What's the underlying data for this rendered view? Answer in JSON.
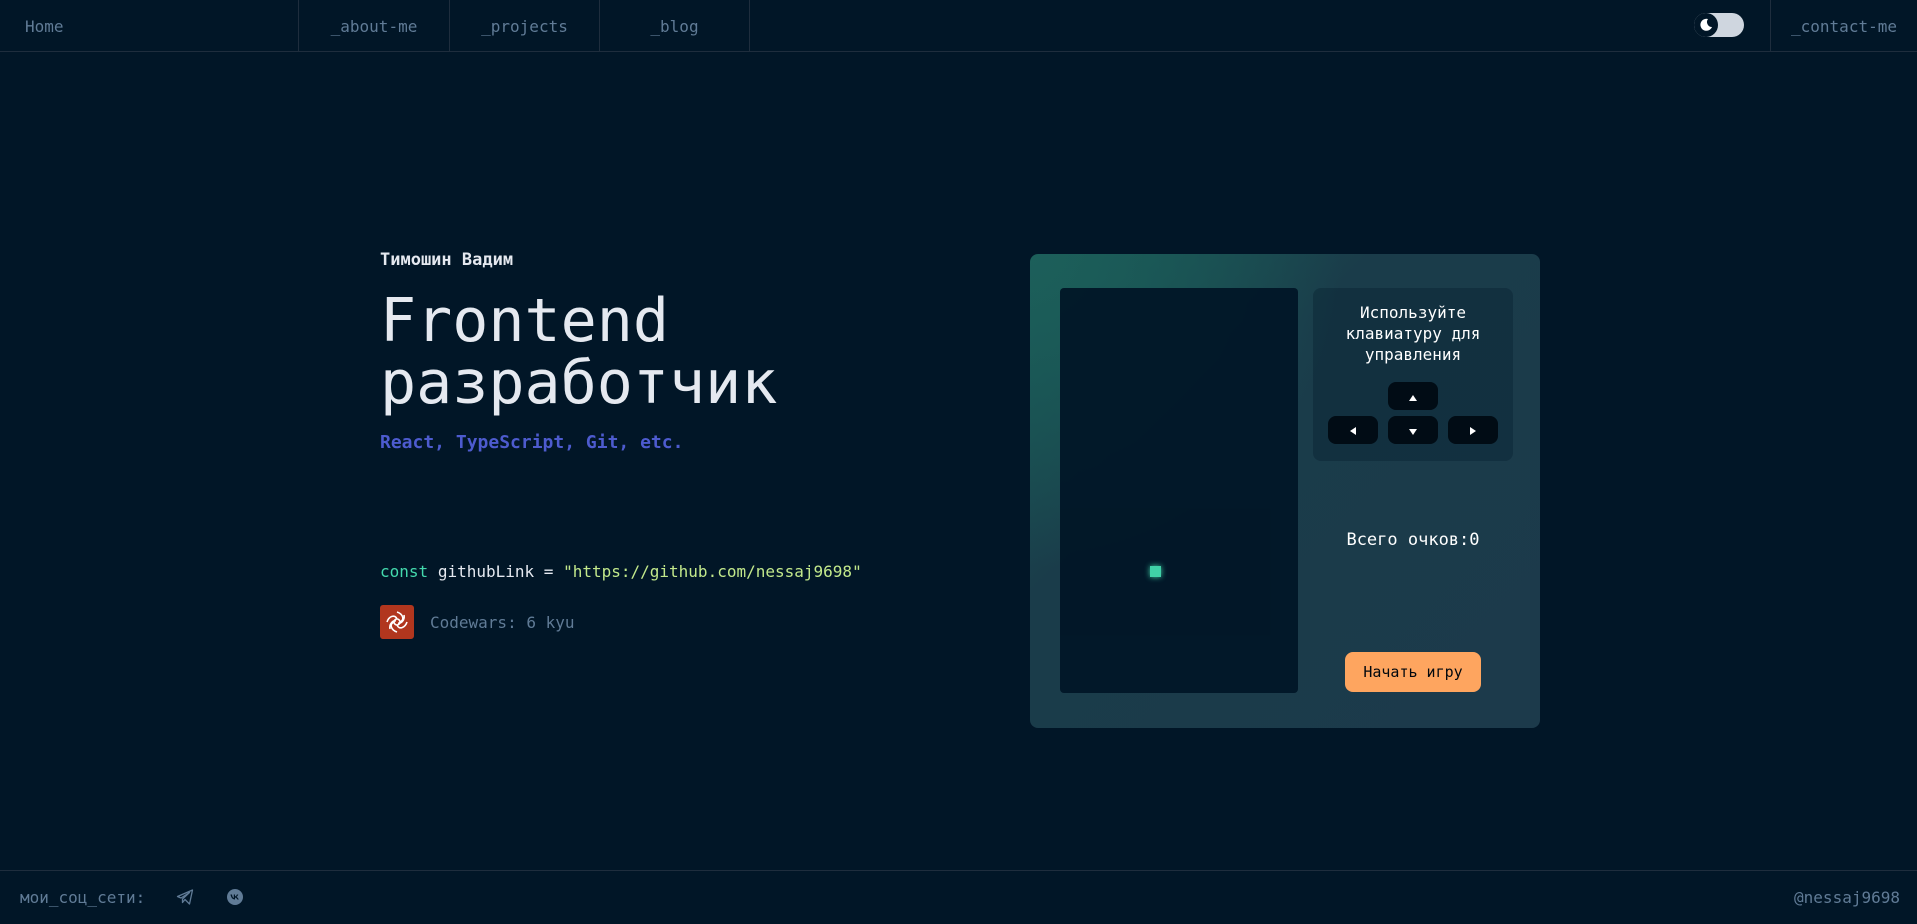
{
  "nav": {
    "home": "Home",
    "about": "_about-me",
    "projects": "_projects",
    "blog": "_blog",
    "contact": "_contact-me"
  },
  "hero": {
    "name": "Тимошин Вадим",
    "title_line1": "Frontend",
    "title_line2": "разработчик",
    "skills": "React, TypeScript, Git, etc."
  },
  "code": {
    "keyword": "const",
    "variable": "githubLink",
    "operator": "=",
    "quote_open": "\"",
    "url": "https://github.com/nessaj9698",
    "quote_close": "\""
  },
  "codewars": {
    "text": "Codewars: 6 kyu"
  },
  "game": {
    "instructions": "Используйте клавиатуру для управления",
    "score_label": "Всего очков:",
    "score_value": "0",
    "start_button": "Начать игру"
  },
  "footer": {
    "label": "мои_соц_сети:",
    "handle": "@nessaj9698"
  },
  "icons": {
    "theme_toggle": "moon-icon",
    "social": [
      "telegram-icon",
      "vk-icon"
    ],
    "arrows": [
      "arrow-up-icon",
      "arrow-left-icon",
      "arrow-down-icon",
      "arrow-right-icon"
    ],
    "codewars": "codewars-logo"
  },
  "colors": {
    "background": "#011627",
    "text_muted": "#607b96",
    "accent_blue": "#4d5bce",
    "accent_green": "#43d9ad",
    "string_green": "#c2e88b",
    "button_orange": "#fea55f"
  }
}
